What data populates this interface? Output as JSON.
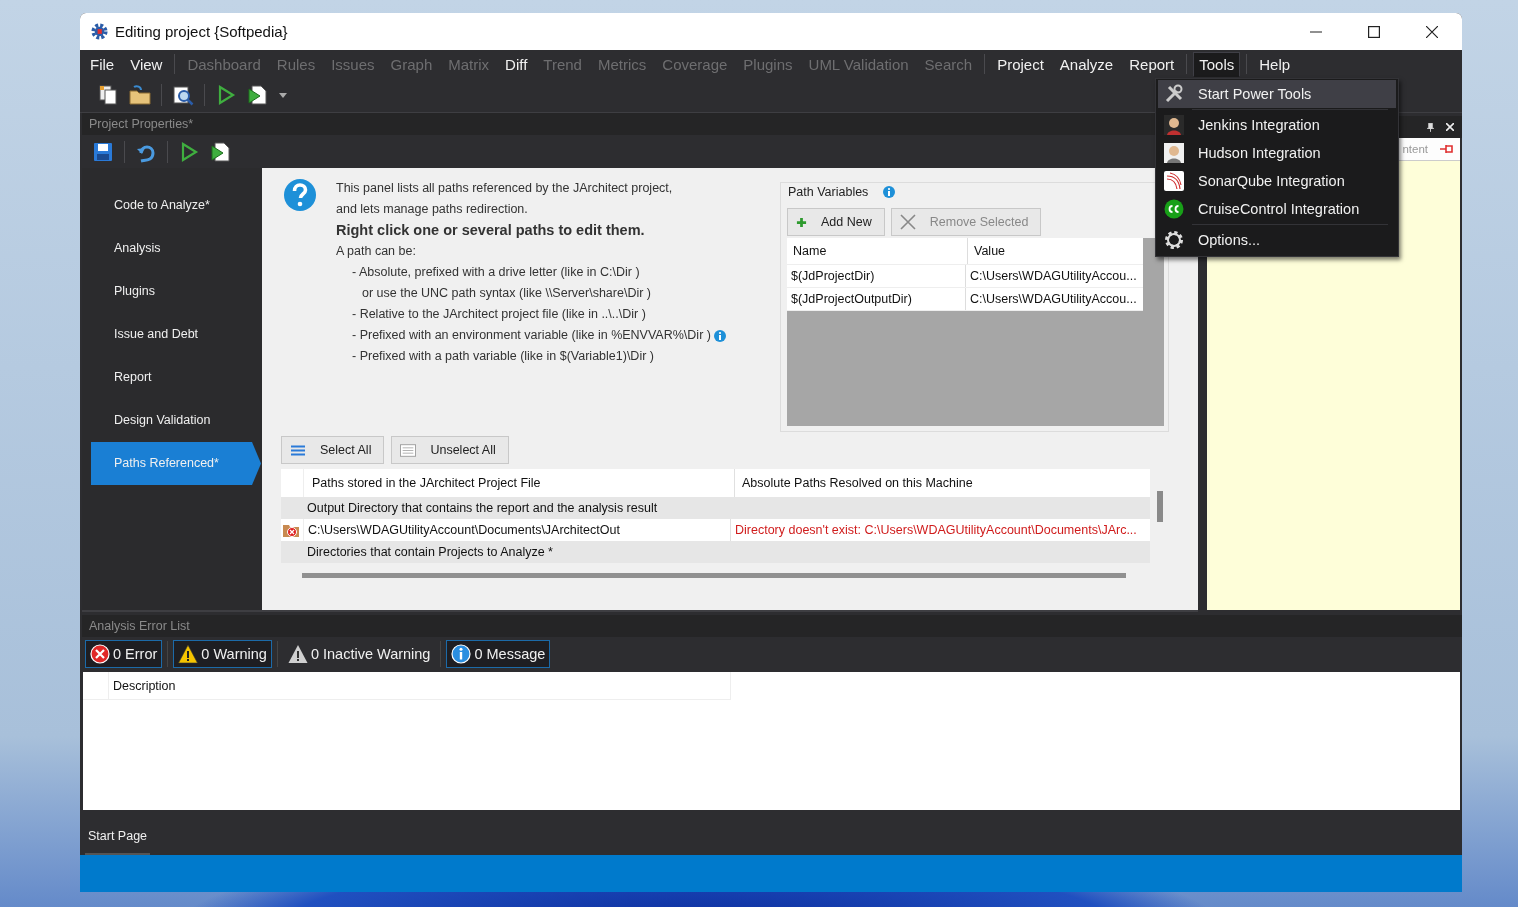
{
  "window": {
    "title": "Editing project {Softpedia}"
  },
  "menu_bar": [
    {
      "label": "File",
      "disabled": false,
      "selected": false,
      "separator_after": false
    },
    {
      "label": "View",
      "disabled": false,
      "selected": false,
      "separator_after": true
    },
    {
      "label": "Dashboard",
      "disabled": true,
      "selected": false,
      "separator_after": false
    },
    {
      "label": "Rules",
      "disabled": true,
      "selected": false,
      "separator_after": false
    },
    {
      "label": "Issues",
      "disabled": true,
      "selected": false,
      "separator_after": false
    },
    {
      "label": "Graph",
      "disabled": true,
      "selected": false,
      "separator_after": false
    },
    {
      "label": "Matrix",
      "disabled": true,
      "selected": false,
      "separator_after": false
    },
    {
      "label": "Diff",
      "disabled": false,
      "selected": false,
      "separator_after": false
    },
    {
      "label": "Trend",
      "disabled": true,
      "selected": false,
      "separator_after": false
    },
    {
      "label": "Metrics",
      "disabled": true,
      "selected": false,
      "separator_after": false
    },
    {
      "label": "Coverage",
      "disabled": true,
      "selected": false,
      "separator_after": false
    },
    {
      "label": "Plugins",
      "disabled": true,
      "selected": false,
      "separator_after": false
    },
    {
      "label": "UML Validation",
      "disabled": true,
      "selected": false,
      "separator_after": false
    },
    {
      "label": "Search",
      "disabled": true,
      "selected": false,
      "separator_after": true
    },
    {
      "label": "Project",
      "disabled": false,
      "selected": false,
      "separator_after": false
    },
    {
      "label": "Analyze",
      "disabled": false,
      "selected": false,
      "separator_after": false
    },
    {
      "label": "Report",
      "disabled": false,
      "selected": false,
      "separator_after": true
    },
    {
      "label": "Tools",
      "disabled": false,
      "selected": true,
      "separator_after": true
    },
    {
      "label": "Help",
      "disabled": false,
      "selected": false,
      "separator_after": false
    }
  ],
  "tools_menu": [
    {
      "label": "Start Power Tools",
      "selected": true,
      "separator_after": true
    },
    {
      "label": "Jenkins Integration",
      "selected": false,
      "separator_after": false
    },
    {
      "label": "Hudson Integration",
      "selected": false,
      "separator_after": false
    },
    {
      "label": "SonarQube Integration",
      "selected": false,
      "separator_after": false
    },
    {
      "label": "CruiseControl Integration",
      "selected": false,
      "separator_after": true
    },
    {
      "label": "Options...",
      "selected": false,
      "separator_after": false
    }
  ],
  "project_panel": {
    "title": "Project Properties*",
    "sidebar": [
      {
        "label": "Code to Analyze*",
        "selected": false
      },
      {
        "label": "Analysis",
        "selected": false
      },
      {
        "label": "Plugins",
        "selected": false
      },
      {
        "label": "Issue and Debt",
        "selected": false
      },
      {
        "label": "Report",
        "selected": false
      },
      {
        "label": "Design Validation",
        "selected": false
      },
      {
        "label": "Paths Referenced*",
        "selected": true
      }
    ],
    "help": [
      {
        "kind": "text",
        "text": "This panel lists all paths referenced by the JArchitect project,",
        "info": false
      },
      {
        "kind": "text",
        "text": "and lets manage paths redirection.",
        "info": false
      },
      {
        "kind": "bold",
        "text": "Right click one or several paths to edit them.",
        "info": false
      },
      {
        "kind": "text",
        "text": "A path can  be:",
        "info": false
      },
      {
        "kind": "item",
        "text": "- Absolute, prefixed with a drive letter (like in C:\\Dir )",
        "info": false
      },
      {
        "kind": "cont",
        "text": "or use the UNC path syntax (like \\\\Server\\share\\Dir )",
        "info": false
      },
      {
        "kind": "item",
        "text": "- Relative to the JArchitect project file (like in ..\\..\\Dir )",
        "info": false
      },
      {
        "kind": "item",
        "text": "- Prefixed with an environment variable (like in %ENVVAR%\\Dir )",
        "info": true
      },
      {
        "kind": "item",
        "text": "- Prefixed with a path variable (like in $(Variable1)\\Dir )",
        "info": false
      }
    ],
    "path_variables": {
      "title": "Path Variables",
      "buttons": [
        {
          "kind": "add",
          "label": "Add New",
          "disabled": false
        },
        {
          "kind": "remove",
          "label": "Remove Selected",
          "disabled": true
        }
      ],
      "columns": [
        "Name",
        "Value"
      ],
      "rows": [
        [
          "$(JdProjectDir)",
          "C:\\Users\\WDAGUtilityAccou..."
        ],
        [
          "$(JdProjectOutputDir)",
          "C:\\Users\\WDAGUtilityAccou..."
        ]
      ]
    },
    "select_buttons": [
      {
        "kind": "select",
        "label": "Select All"
      },
      {
        "kind": "unselect",
        "label": "Unselect All"
      }
    ],
    "paths_table": {
      "columns": [
        "Paths stored in the JArchitect Project File",
        "Absolute Paths Resolved on this Machine"
      ],
      "rows": [
        {
          "kind": "group",
          "text": "Output Directory that contains the report and the analysis result"
        },
        {
          "kind": "path",
          "path": "C:\\Users\\WDAGUtilityAccount\\Documents\\JArchitectOut",
          "resolved": "Directory doesn't exist: C:\\Users\\WDAGUtilityAccount\\Documents\\JArc...",
          "error": true
        },
        {
          "kind": "group",
          "text": "Directories that contain Projects to Analyze *"
        }
      ]
    }
  },
  "right_panel": {
    "tab_fragment": "ntent"
  },
  "error_list": {
    "title": "Analysis Error List",
    "filters": [
      {
        "kind": "error",
        "label": "0 Error",
        "selected": true
      },
      {
        "kind": "warning",
        "label": "0 Warning",
        "selected": true
      },
      {
        "kind": "inactive",
        "label": "0 Inactive Warning",
        "selected": false
      },
      {
        "kind": "message",
        "label": "0 Message",
        "selected": true
      }
    ],
    "columns": [
      "Description"
    ]
  },
  "document_tabs": [
    {
      "label": "Start Page",
      "selected": true
    }
  ]
}
